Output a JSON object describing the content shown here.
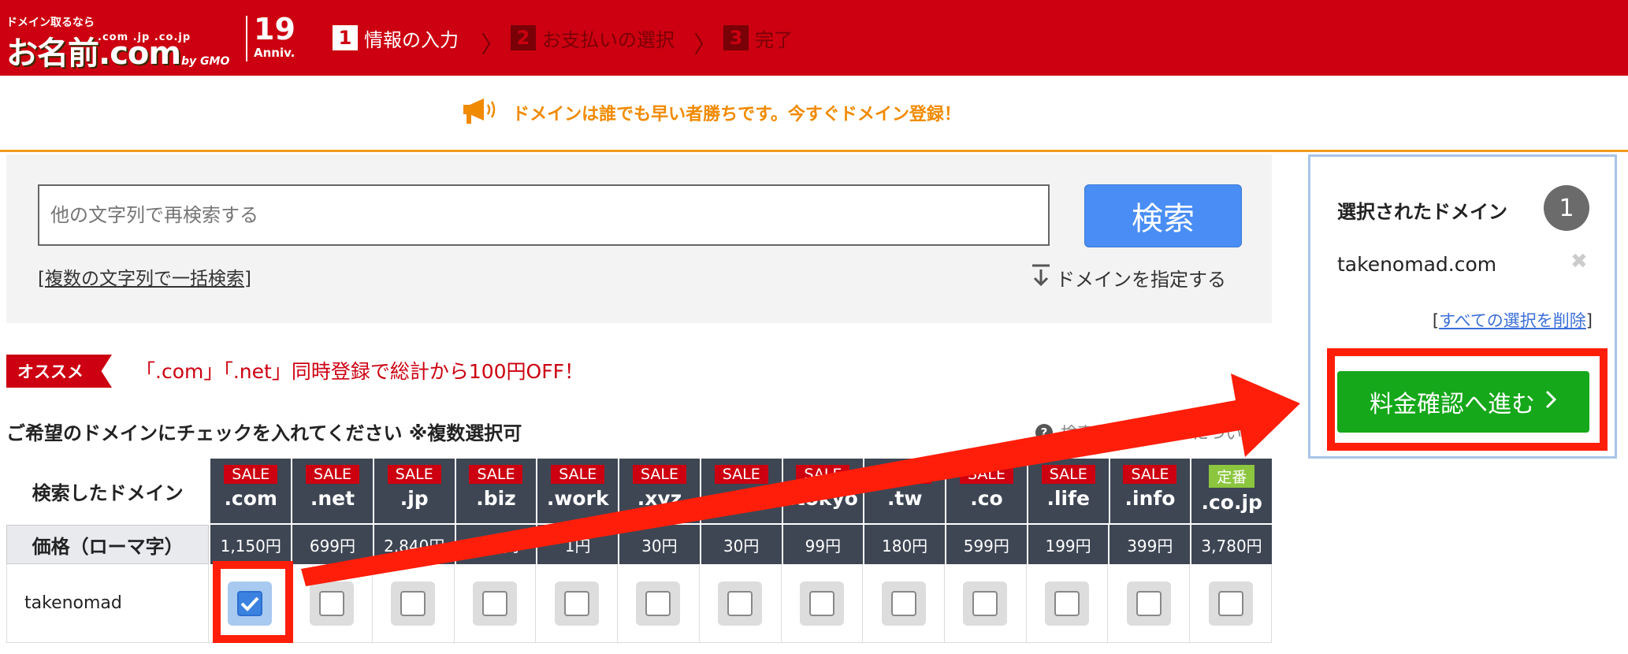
{
  "header": {
    "logo_tagline": "ドメイン取るなら",
    "logo_tlds": ".com .jp .co.jp",
    "logo_main": "お名前.com",
    "logo_by": "by GMO",
    "anniv_number": "19",
    "anniv_text": "Anniv.",
    "steps": [
      {
        "num": "1",
        "label": "情報の入力",
        "state": "active"
      },
      {
        "num": "2",
        "label": "お支払いの選択",
        "state": "inactive"
      },
      {
        "num": "3",
        "label": "完了",
        "state": "inactive"
      }
    ]
  },
  "notice": {
    "icon": "megaphone-icon",
    "text": "ドメインは誰でも早い者勝ちです。今すぐドメイン登録！"
  },
  "search": {
    "placeholder": "他の文字列で再検索する",
    "button_label": "検索",
    "bulk_link": "複数の文字列で一括検索",
    "specify_label": "ドメインを指定する"
  },
  "promo": {
    "badge": "オススメ",
    "text": "「.com」「.net」同時登録で総計から100円OFF！"
  },
  "instructions": {
    "text": "ご希望のドメインにチェックを入れてください ※複数選択可",
    "help_text": "検索結果アイコンについて"
  },
  "table": {
    "header_label": "検索したドメイン",
    "price_label": "価格（ローマ字）",
    "search_term": "takenomad",
    "tlds": [
      {
        "badge": "SALE",
        "tld": ".com",
        "price": "1,150円",
        "checked": true
      },
      {
        "badge": "SALE",
        "tld": ".net",
        "price": "699円",
        "checked": false
      },
      {
        "badge": "SALE",
        "tld": ".jp",
        "price": "2,840円",
        "checked": false
      },
      {
        "badge": "SALE",
        "tld": ".biz",
        "price": "300円",
        "checked": false
      },
      {
        "badge": "SALE",
        "tld": ".work",
        "price": "1円",
        "checked": false
      },
      {
        "badge": "SALE",
        "tld": ".xyz",
        "price": "30円",
        "checked": false
      },
      {
        "badge": "SALE",
        "tld": ".site",
        "price": "30円",
        "checked": false
      },
      {
        "badge": "SALE",
        "tld": ".tokyo",
        "price": "99円",
        "checked": false
      },
      {
        "badge": "SALE",
        "tld": ".tw",
        "price": "180円",
        "checked": false
      },
      {
        "badge": "SALE",
        "tld": ".co",
        "price": "599円",
        "checked": false
      },
      {
        "badge": "SALE",
        "tld": ".life",
        "price": "199円",
        "checked": false
      },
      {
        "badge": "SALE",
        "tld": ".info",
        "price": "399円",
        "checked": false
      },
      {
        "badge": "定番",
        "tld": ".co.jp",
        "price": "3,780円",
        "checked": false
      }
    ]
  },
  "selected_panel": {
    "title": "選択されたドメイン",
    "count": "1",
    "domain": "takenomad.com",
    "remove_icon": "close-icon",
    "clear_all": "すべての選択を削除",
    "proceed_label": "料金確認へ進む"
  },
  "colors": {
    "brand_red": "#cc0010",
    "accent_orange": "#f08a00",
    "search_blue": "#4a8ef5",
    "proceed_green": "#15a81a",
    "annotation_red": "#ff1e0a"
  }
}
